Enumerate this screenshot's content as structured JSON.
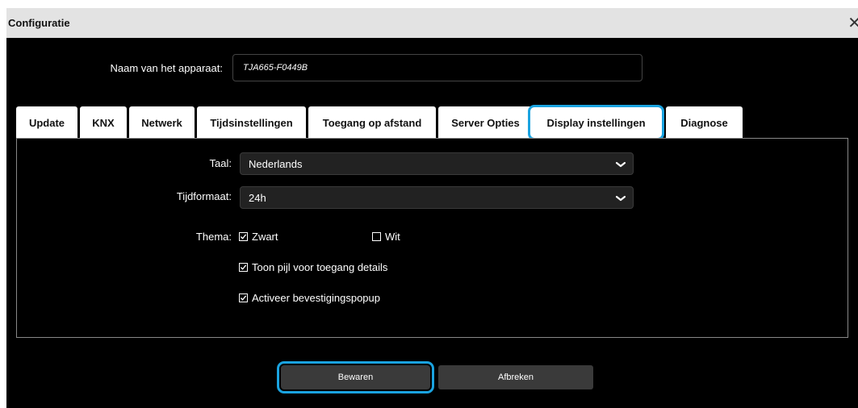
{
  "window": {
    "title": "Configuratie",
    "close_icon": "close-icon"
  },
  "device": {
    "name_label": "Naam van het apparaat:",
    "name_value": "TJA665-F0449B"
  },
  "tabs": [
    {
      "label": "Update",
      "active": false
    },
    {
      "label": "KNX",
      "active": false
    },
    {
      "label": "Netwerk",
      "active": false
    },
    {
      "label": "Tijdsinstellingen",
      "active": false
    },
    {
      "label": "Toegang op afstand",
      "active": false
    },
    {
      "label": "Server Opties",
      "active": false
    },
    {
      "label": "Display instellingen",
      "active": true
    },
    {
      "label": "Diagnose",
      "active": false
    }
  ],
  "display_settings": {
    "language_label": "Taal:",
    "language_value": "Nederlands",
    "time_format_label": "Tijdformaat:",
    "time_format_value": "24h",
    "theme_label": "Thema:",
    "theme_black_label": "Zwart",
    "theme_black_checked": true,
    "theme_white_label": "Wit",
    "theme_white_checked": false,
    "show_arrow_label": "Toon pijl voor toegang details",
    "show_arrow_checked": true,
    "confirm_popup_label": "Activeer bevestigingspopup",
    "confirm_popup_checked": true
  },
  "buttons": {
    "save_label": "Bewaren",
    "cancel_label": "Afbreken"
  },
  "colors": {
    "highlight": "#1aa3e0",
    "background": "#000000",
    "tab_bg": "#ffffff",
    "button_bg": "#3a3a3a"
  }
}
